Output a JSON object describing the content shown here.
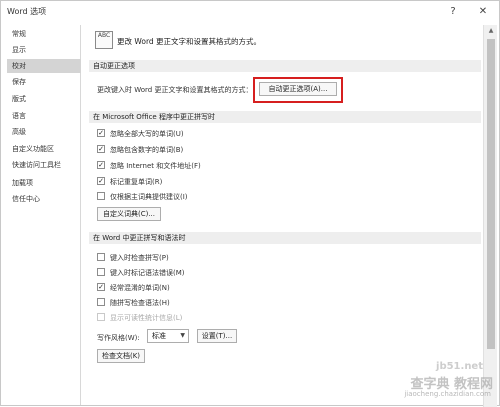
{
  "window": {
    "title": "Word 选项",
    "help_icon": "?",
    "close_icon": "✕"
  },
  "sidebar": {
    "items": [
      {
        "label": "常规"
      },
      {
        "label": "显示"
      },
      {
        "label": "校对",
        "active": true
      },
      {
        "label": "保存"
      },
      {
        "label": "版式"
      },
      {
        "label": "语言"
      },
      {
        "label": "高级"
      },
      {
        "label": "自定义功能区"
      },
      {
        "label": "快速访问工具栏"
      },
      {
        "label": "加载项"
      },
      {
        "label": "信任中心"
      }
    ]
  },
  "header": {
    "icon_text": "ABC",
    "text": "更改 Word 更正文字和设置其格式的方式。"
  },
  "autocorrect": {
    "section_title": "自动更正选项",
    "description": "更改键入时 Word 更正文字和设置其格式的方式：",
    "button_label": "自动更正选项(A)..."
  },
  "office_spelling": {
    "section_title": "在 Microsoft Office 程序中更正拼写时",
    "options": [
      {
        "label": "忽略全部大写的单词(U)",
        "checked": true
      },
      {
        "label": "忽略包含数字的单词(B)",
        "checked": true
      },
      {
        "label": "忽略 Internet 和文件地址(F)",
        "checked": true
      },
      {
        "label": "标记重复单词(R)",
        "checked": true
      },
      {
        "label": "仅根据主词典提供建议(I)",
        "checked": false
      }
    ],
    "dictionary_button": "自定义词典(C)..."
  },
  "word_spelling": {
    "section_title": "在 Word 中更正拼写和语法时",
    "options": [
      {
        "label": "键入时检查拼写(P)",
        "checked": false,
        "disabled": false
      },
      {
        "label": "键入时标记语法错误(M)",
        "checked": false,
        "disabled": false
      },
      {
        "label": "经常混淆的单词(N)",
        "checked": true,
        "disabled": false
      },
      {
        "label": "随拼写检查语法(H)",
        "checked": false,
        "disabled": false
      },
      {
        "label": "显示可读性统计信息(L)",
        "checked": false,
        "disabled": true
      }
    ],
    "writing_style_label": "写作风格(W):",
    "writing_style_value": "标准",
    "settings_button": "设置(T)...",
    "check_document_button": "检查文档(K)"
  },
  "watermark": {
    "line1": "jb51.net",
    "line2": "查字典 教程网",
    "line3": "jiaocheng.chazidian.com"
  }
}
